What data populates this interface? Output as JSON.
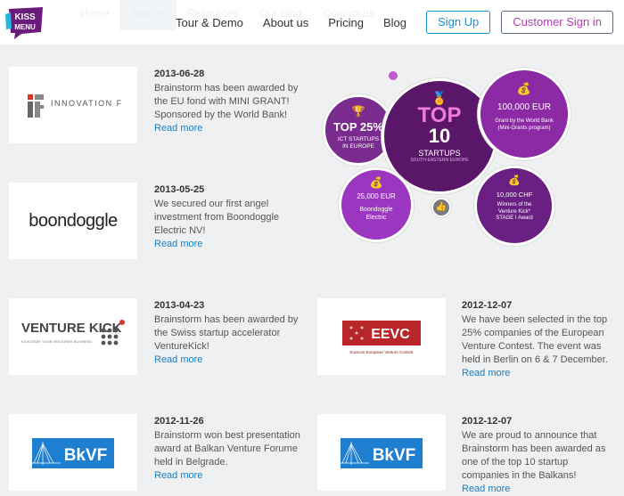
{
  "nav": {
    "ghost": [
      "Home",
      "Awards",
      "Resources",
      "Our Blog",
      "Contact us"
    ],
    "items": [
      "Tour & Demo",
      "About us",
      "Pricing",
      "Blog"
    ],
    "signup": "Sign Up",
    "signin": "Customer Sign in"
  },
  "logo": {
    "text": "KISS MENU"
  },
  "awards": [
    {
      "date": "2013-06-28",
      "lines": [
        "Brainstorm has been awarded by",
        "the EU fond with MINI GRANT!",
        "Sponsored by the World Bank!"
      ],
      "more": "Read more",
      "logo": "INNOVATION FUND"
    },
    {
      "date": "2013-05-25",
      "lines": [
        "We secured our first angel",
        "investment from Boondoggle",
        "Electric NV!"
      ],
      "more": "Read more",
      "logo": "boondoggle"
    },
    {
      "date": "2013-04-23",
      "lines": [
        "Brainstorm has been awarded by",
        "the Swiss startup accelerator",
        "VentureKick!"
      ],
      "more": "Read more",
      "logo": "VENTURE KICK",
      "logo_sub": "KICKSTART YOUR VENTURES BUSINESS"
    },
    {
      "date": "2012-12-07",
      "lines": [
        "We have been selected in the top",
        "25% companies of the European",
        "Venture Contest. The event was",
        "held in Berlin on 6 & 7 December."
      ],
      "more": "Read more",
      "logo": "EEVC",
      "logo_sub": "Eurecan European Venture Contest"
    },
    {
      "date": "2012-11-26",
      "lines": [
        "Brainstorm won best presentation",
        "award at Balkan Venture Forume",
        "held in Belgrade."
      ],
      "more": "Read more",
      "logo": "BkVF"
    },
    {
      "date": "2012-12-07",
      "lines": [
        "We are proud to announce that",
        "Brainstorm has been awarded as",
        "one of the top 10 startup",
        "companies in the Balkans!"
      ],
      "more": "Read more",
      "logo": "BkVF"
    }
  ],
  "badges": {
    "top25": {
      "big": "TOP 25%",
      "small": "ICT STARTUPS IN EUROPE"
    },
    "top10": {
      "big1": "TOP",
      "big2": "10",
      "mid": "STARTUPS",
      "small": "SOUTH-EASTERN EUROPE"
    },
    "eur100": {
      "big": "100,000 EUR",
      "small": "Grant by the World Bank (Mini-Grants program)"
    },
    "eur25": {
      "big": "25,000 EUR",
      "small": "Boondoggle Electric"
    },
    "chf10": {
      "big": "10,000 CHF",
      "small": "Winners of the Venture Kick* STAGE I Award"
    }
  },
  "colors": {
    "purple": "#6a1b7c",
    "purple_light": "#9b3ab0",
    "link": "#1a7ec4",
    "signin": "#b23eb0",
    "signup": "#1a8fd0"
  }
}
